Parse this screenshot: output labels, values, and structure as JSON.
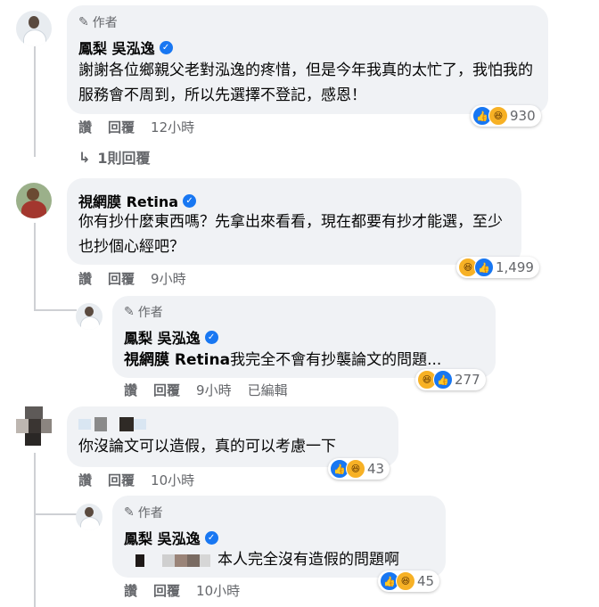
{
  "comments": [
    {
      "author_tag": "作者",
      "name": "鳳梨 吳泓逸",
      "text": "謝謝各位鄉親父老對泓逸的疼惜，但是今年我真的太忙了，我怕我的服務會不周到，所以先選擇不登記，感恩！",
      "like": "讚",
      "reply": "回覆",
      "time": "12小時",
      "reaction_count": "930",
      "replies_link": "1則回覆"
    },
    {
      "name": "視網膜 Retina",
      "text": "你有抄什麼東西嗎？先拿出來看看，現在都要有抄才能選，至少也抄個心經吧？",
      "like": "讚",
      "reply": "回覆",
      "time": "9小時",
      "reaction_count": "1,499"
    },
    {
      "author_tag": "作者",
      "name": "鳳梨 吳泓逸",
      "mention": "視網膜 Retina",
      "text": "我完全不會有抄襲論文的問題...",
      "like": "讚",
      "reply": "回覆",
      "time": "9小時",
      "edited": "已編輯",
      "reaction_count": "277"
    },
    {
      "text": "你沒論文可以造假，真的可以考慮一下",
      "like": "讚",
      "reply": "回覆",
      "time": "10小時",
      "reaction_count": "43"
    },
    {
      "author_tag": "作者",
      "name": "鳳梨 吳泓逸",
      "text": "本人完全沒有造假的問題啊",
      "like": "讚",
      "reply": "回覆",
      "time": "10小時",
      "reaction_count": "45"
    }
  ],
  "colors": {
    "bubble": "#f0f2f5",
    "verified": "#1877f2",
    "muted": "#65676b",
    "like": "#1877f2",
    "haha": "#f7b125"
  },
  "icons": {
    "author": "pencil-icon",
    "verified": "verified-badge-icon",
    "reply_arrow": "reply-arrow-icon",
    "like": "like-reaction-icon",
    "haha": "haha-reaction-icon"
  }
}
